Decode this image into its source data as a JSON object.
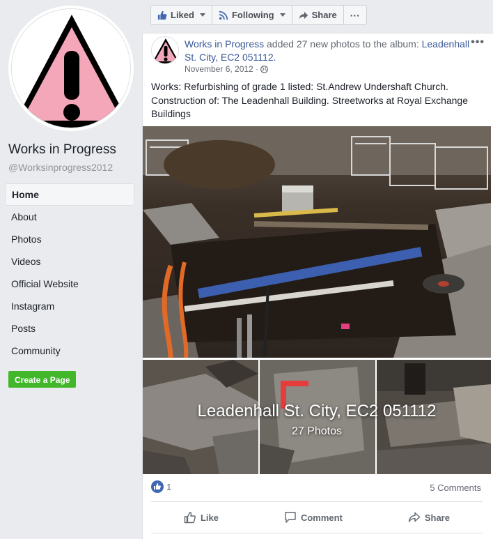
{
  "page": {
    "name": "Works in Progress",
    "handle": "@Worksinprogress2012"
  },
  "sidebar": {
    "items": [
      {
        "label": "Home",
        "active": true
      },
      {
        "label": "About"
      },
      {
        "label": "Photos"
      },
      {
        "label": "Videos"
      },
      {
        "label": "Official Website"
      },
      {
        "label": "Instagram"
      },
      {
        "label": "Posts"
      },
      {
        "label": "Community"
      }
    ],
    "create_page_label": "Create a Page"
  },
  "actionbar": {
    "liked_label": "Liked",
    "following_label": "Following",
    "share_label": "Share",
    "more_label": "···"
  },
  "post": {
    "author": "Works in Progress",
    "action_text": " added 27 new photos to the album: ",
    "album_link": "Leadenhall St. City, EC2 051112.",
    "date": "November 6, 2012 ·",
    "more_label": "•••",
    "text": "Works: Refurbishing of grade 1 listed: St.Andrew Undershaft Church. Construction of: The Leadenhall Building. Streetworks at Royal Exchange Buildings",
    "album_title": "Leadenhall St. City, EC2 051112",
    "album_count": "27 Photos",
    "reaction_count": "1",
    "comments_count": "5 Comments"
  },
  "actions": {
    "like": "Like",
    "comment": "Comment",
    "share": "Share"
  },
  "colors": {
    "link": "#385898",
    "facebook_blue": "#4267b2",
    "green": "#42b72a",
    "warning_pink": "#f4a7b9"
  }
}
